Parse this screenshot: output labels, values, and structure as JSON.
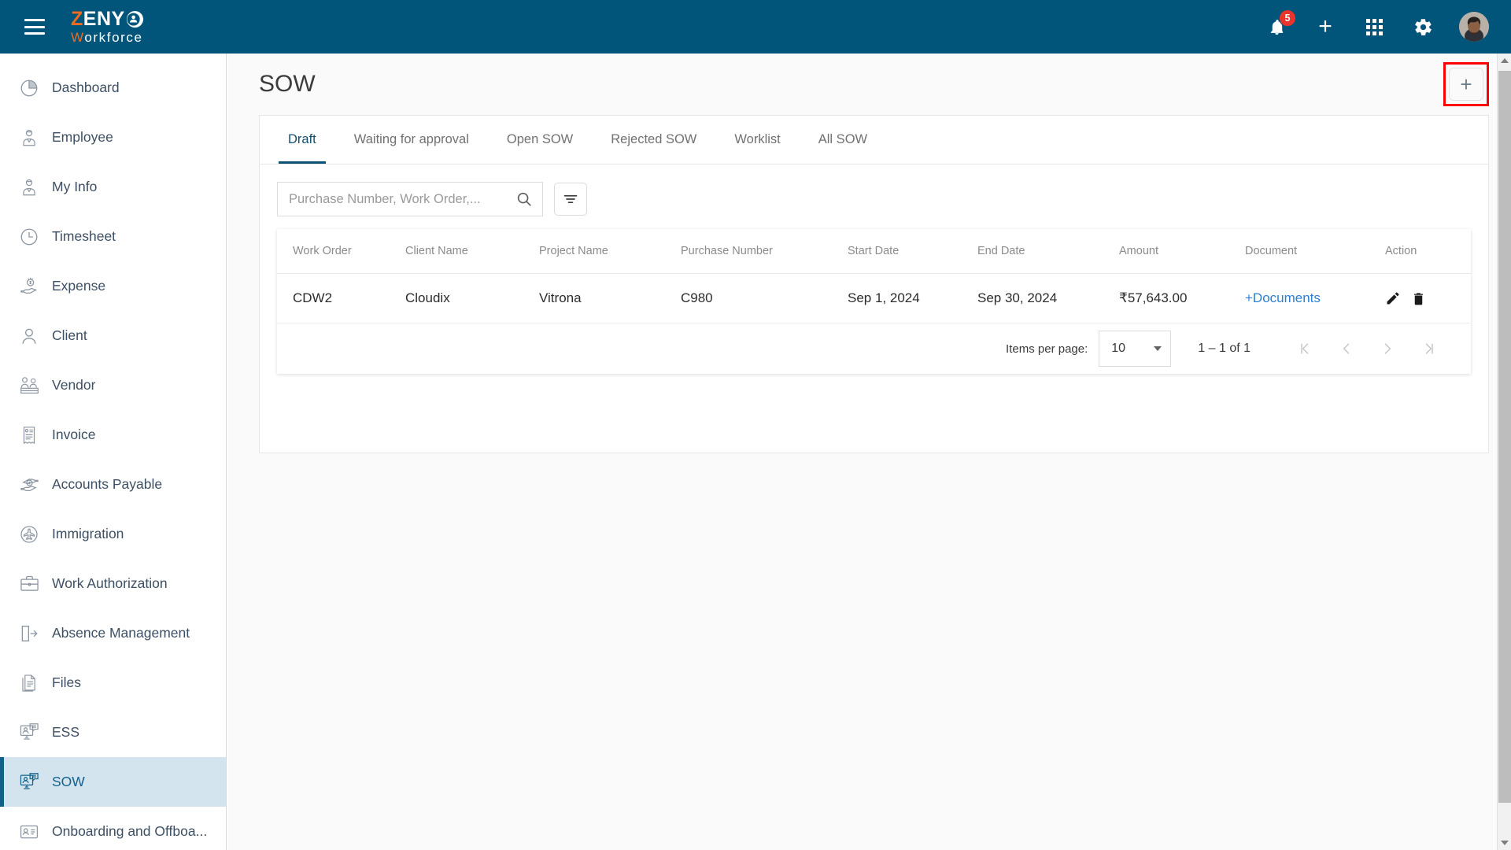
{
  "brand": {
    "logo_z": "Z",
    "logo_eny": "ENY",
    "logo_w": "W",
    "logo_orkforce": "orkforce",
    "header_color": "#02557a",
    "accent_orange": "#ef6c1f"
  },
  "header": {
    "menu_icon": "hamburger-icon",
    "notifications_icon": "bell-icon",
    "notifications_count": "5",
    "add_icon": "plus-icon",
    "apps_icon": "grid-apps-icon",
    "settings_icon": "gear-icon",
    "avatar_icon": "user-avatar"
  },
  "sidebar": {
    "items": [
      {
        "label": "Dashboard",
        "icon": "pie-chart-icon",
        "active": false
      },
      {
        "label": "Employee",
        "icon": "employee-icon",
        "active": false
      },
      {
        "label": "My Info",
        "icon": "my-info-icon",
        "active": false
      },
      {
        "label": "Timesheet",
        "icon": "clock-icon",
        "active": false
      },
      {
        "label": "Expense",
        "icon": "expense-hand-money-icon",
        "active": false
      },
      {
        "label": "Client",
        "icon": "person-icon",
        "active": false
      },
      {
        "label": "Vendor",
        "icon": "vendor-icon",
        "active": false
      },
      {
        "label": "Invoice",
        "icon": "invoice-document-icon",
        "active": false
      },
      {
        "label": "Accounts Payable",
        "icon": "accounts-payable-icon",
        "active": false
      },
      {
        "label": "Immigration",
        "icon": "airplane-circle-icon",
        "active": false
      },
      {
        "label": "Work Authorization",
        "icon": "briefcase-icon",
        "active": false
      },
      {
        "label": "Absence Management",
        "icon": "door-exit-icon",
        "active": false
      },
      {
        "label": "Files",
        "icon": "files-icon",
        "active": false
      },
      {
        "label": "ESS",
        "icon": "monitor-chat-icon",
        "active": false
      },
      {
        "label": "SOW",
        "icon": "monitor-chat-icon",
        "active": true
      },
      {
        "label": "Onboarding and Offboa...",
        "icon": "id-card-icon",
        "active": false
      }
    ]
  },
  "page": {
    "title": "SOW",
    "add_button_label": "+",
    "add_button_highlight_color": "#fb0007"
  },
  "tabs": [
    {
      "label": "Draft",
      "active": true
    },
    {
      "label": "Waiting for approval",
      "active": false
    },
    {
      "label": "Open SOW",
      "active": false
    },
    {
      "label": "Rejected SOW",
      "active": false
    },
    {
      "label": "Worklist",
      "active": false
    },
    {
      "label": "All SOW",
      "active": false
    }
  ],
  "toolbar": {
    "search_placeholder": "Purchase Number, Work Order,...",
    "search_value": "",
    "search_icon": "search-icon",
    "filter_icon": "filter-icon"
  },
  "table": {
    "columns": [
      "Work Order",
      "Client Name",
      "Project Name",
      "Purchase Number",
      "Start Date",
      "End Date",
      "Amount",
      "Document",
      "Action"
    ],
    "rows": [
      {
        "work_order": "CDW2",
        "client_name": "Cloudix",
        "project_name": "Vitrona",
        "purchase_number": "C980",
        "start_date": "Sep 1, 2024",
        "end_date": "Sep 30, 2024",
        "amount": "₹57,643.00",
        "document": "+Documents",
        "edit_icon": "pencil-edit-icon",
        "delete_icon": "trash-delete-icon"
      }
    ]
  },
  "pagination": {
    "items_per_page_label": "Items per page:",
    "items_per_page_value": "10",
    "range_label": "1 – 1 of 1",
    "first_icon": "first-page-icon",
    "prev_icon": "previous-page-icon",
    "next_icon": "next-page-icon",
    "last_icon": "last-page-icon"
  }
}
